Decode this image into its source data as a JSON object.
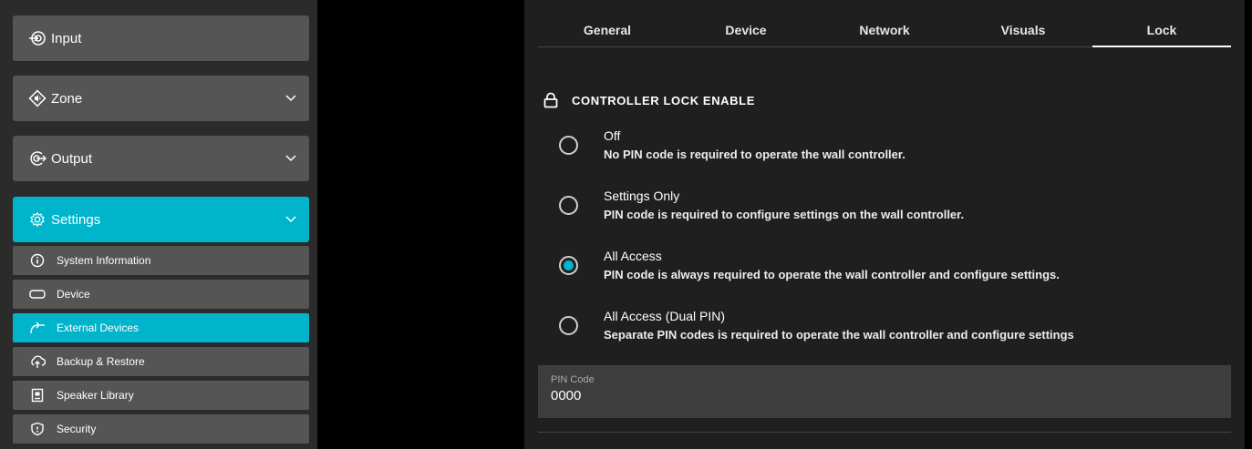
{
  "sidebar": {
    "main_items": [
      {
        "label": "Input",
        "icon": "input-icon",
        "expanded": false
      },
      {
        "label": "Zone",
        "icon": "zone-icon",
        "expanded": false
      },
      {
        "label": "Output",
        "icon": "output-icon",
        "expanded": false
      },
      {
        "label": "Settings",
        "icon": "gear-icon",
        "expanded": true
      }
    ],
    "sub_items": [
      {
        "label": "System Information",
        "icon": "info-icon"
      },
      {
        "label": "Device",
        "icon": "device-icon"
      },
      {
        "label": "External Devices",
        "icon": "external-devices-icon"
      },
      {
        "label": "Backup & Restore",
        "icon": "cloud-upload-icon"
      },
      {
        "label": "Speaker Library",
        "icon": "speaker-icon"
      },
      {
        "label": "Security",
        "icon": "shield-icon"
      }
    ],
    "active_sub": "External Devices"
  },
  "tabs": [
    "General",
    "Device",
    "Network",
    "Visuals",
    "Lock"
  ],
  "active_tab": "Lock",
  "lock": {
    "section_title": "CONTROLLER LOCK ENABLE",
    "options": [
      {
        "title": "Off",
        "description": "No PIN code is required to operate the wall controller.",
        "selected": false
      },
      {
        "title": "Settings Only",
        "description": "PIN code is required to configure settings on the wall controller.",
        "selected": false
      },
      {
        "title": "All Access",
        "description": "PIN code is always required to operate the wall controller and configure settings.",
        "selected": true
      },
      {
        "title": "All Access (Dual PIN)",
        "description": "Separate PIN codes is required to operate the wall controller and configure settings",
        "selected": false
      }
    ],
    "pin_label": "PIN Code",
    "pin_value": "0000"
  },
  "colors": {
    "accent": "#00b4cc",
    "nav_bg": "#555555",
    "panel_bg": "#1f1f1f"
  }
}
